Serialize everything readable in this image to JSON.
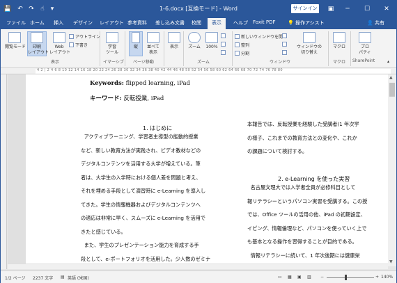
{
  "titlebar": {
    "title": "1-6.docx [互換モード] - Word",
    "signin": "サインイン",
    "qat_save": "💾",
    "qat_undo": "↶",
    "qat_redo": "↷",
    "qat_touch": "☝",
    "qat_more": "▾",
    "restore_ribbon": "▣",
    "minimize": "─",
    "maximize": "☐",
    "close": "✕"
  },
  "tabs": {
    "items": [
      "ファイル",
      "ホーム",
      "挿入",
      "デザイン",
      "レイアウト",
      "参考資料",
      "差し込み文書",
      "校閲",
      "表示",
      "ヘルプ",
      "Foxit PDF"
    ],
    "active": "表示",
    "tell_me": "操作アシスト",
    "share": "共有"
  },
  "ribbon": {
    "read_mode": "閲覧モード",
    "print_layout": "印刷\nレイアウト",
    "web_layout": "Web\nレイアウト",
    "outline": "アウトライン",
    "draft": "下書き",
    "group_view": "表示",
    "learning_tools": "学習\nツール",
    "group_immersive": "イマーシブ",
    "vertical": "縦",
    "side_by_side": "並べて\n表示",
    "group_page_move": "ページ移動",
    "show": "表示",
    "zoom": "ズーム",
    "zoom_100": "100%",
    "group_zoom": "ズーム",
    "new_window": "新しいウィンドウを開く",
    "arrange_all": "整列",
    "split": "分割",
    "switch_windows": "ウィンドウの\n切り替え",
    "group_window": "ウィンドウ",
    "macros": "マクロ",
    "group_macro": "マクロ",
    "properties": "プロ\nパティ",
    "group_sharepoint": "SharePoint"
  },
  "ruler": {
    "text": "4 2 | 2 4 6 8 10 12 14 16 18 20 22 24 26 28 30 32 34 36 38 40 42 44 46 48 50 52 54 56 58 60 62 64 66 68 70 72 74 76 78 80"
  },
  "document": {
    "kw_en_label": "Keywords:",
    "kw_en_value": " flipped learning, iPad",
    "kw_ja_label": "キーワード:",
    "kw_ja_value": " 反転授業, iPad",
    "h1": "1.  はじめに",
    "col1": "  アクティブラーニング、学習者主導型の能動的授業\nなど、新しい教育方法が実践され、ビデオ教材などの\nデジタルコンテンツを活用する大学が増えている。筆\n者は、大学生の入学時における個人差を問題と考え、\nそれを埋める手段として演習時に e-Learning を導入し\nてきた。学生の情報機器およびデジタルコンテンツへ\nの適応は非常に早く、スムーズに e-Learning を活用で\nきたと感じている。\n  また、学生のプレゼンテーション能力を育成する手\n段として、e-ポートフォリオを活用した。少人数のゼミナ",
    "col2a": "本報告では、反転授業を経験した受講者(1 年次学\nの様子、これまでの教育方法との変化や、これか\nの課題について検討する。",
    "h2": "2.  e-Learning を使った実習",
    "col2b": "  名古屋文理大では入学者全員が必修科目として\n報リテラシーというパソコン実習を受講する。この授\nでは、Office ツールの活用の他、iPad の初期設定、\nイピング、情報倫理など、パソコンを使っていく上で\nも基本となる操作を習得することが目的である。\n  情報リテラシーに続いて、1 年次後期には健康栄"
  },
  "status": {
    "page": "1/2 ページ",
    "words": "2237 文字",
    "language": "英語 (米国)",
    "zoom_minus": "−",
    "zoom_plus": "+",
    "zoom_level": "140%"
  },
  "colors": {
    "accent": "#2b579a",
    "ribbon_bg": "#f3f3f3"
  }
}
